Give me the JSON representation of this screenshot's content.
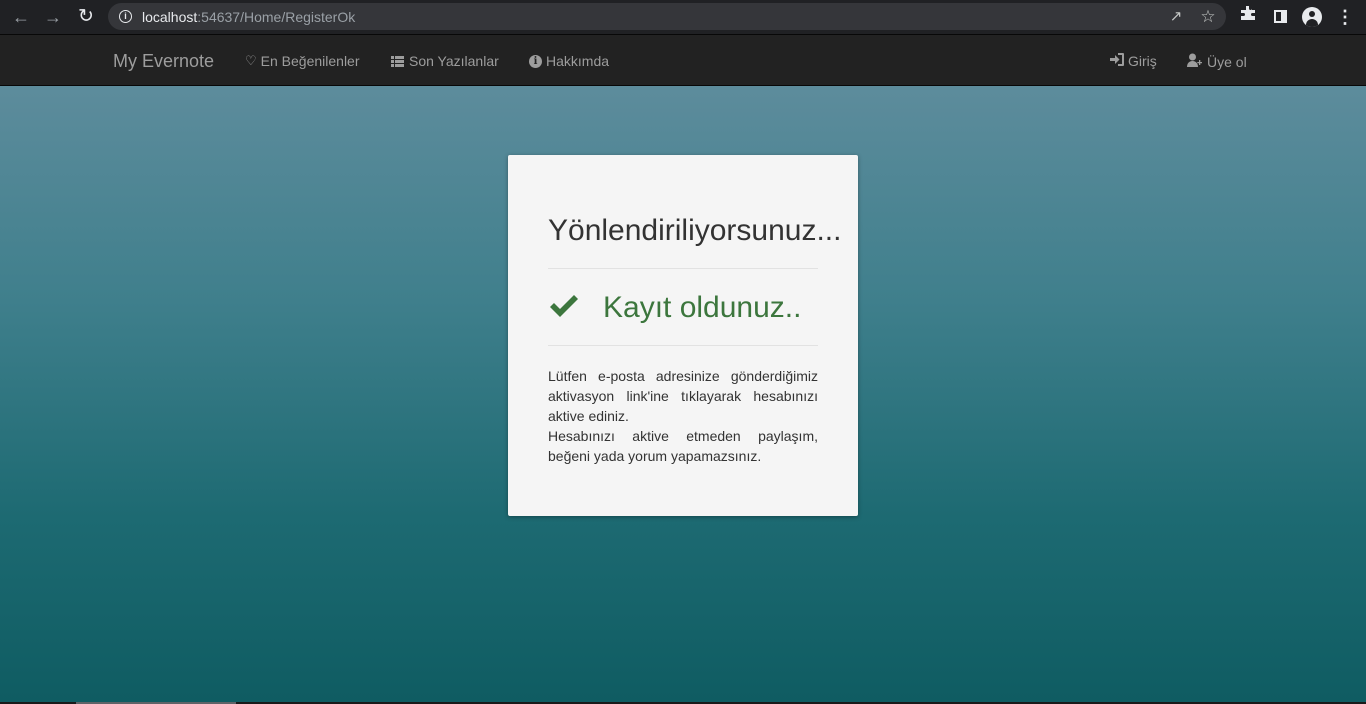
{
  "browser": {
    "url_host": "localhost",
    "url_rest": ":54637/Home/RegisterOk"
  },
  "navbar": {
    "brand": "My Evernote",
    "links": [
      {
        "label": "En Beğenilenler",
        "icon": "heart-icon"
      },
      {
        "label": "Son Yazılanlar",
        "icon": "list-icon"
      },
      {
        "label": "Hakkımda",
        "icon": "info-icon"
      }
    ],
    "right_links": [
      {
        "label": "Giriş",
        "icon": "login-icon"
      },
      {
        "label": "Üye ol",
        "icon": "user-plus-icon"
      }
    ]
  },
  "card": {
    "title": "Yönlendiriliyorsunuz...",
    "success_text": "Kayıt oldunuz..",
    "success_icon": "check-icon",
    "message_lines": [
      "Lütfen e-posta adresinize gönderdiğimiz aktivasyon link'ine tıklayarak hesabınızı aktive ediniz.",
      "Hesabınızı aktive etmeden paylaşım, beğeni yada yorum yapamazsınız."
    ]
  },
  "colors": {
    "navbar_bg": "#222222",
    "nav_text": "#9d9d9d",
    "success": "#3c763d",
    "card_bg": "#f5f5f5"
  }
}
